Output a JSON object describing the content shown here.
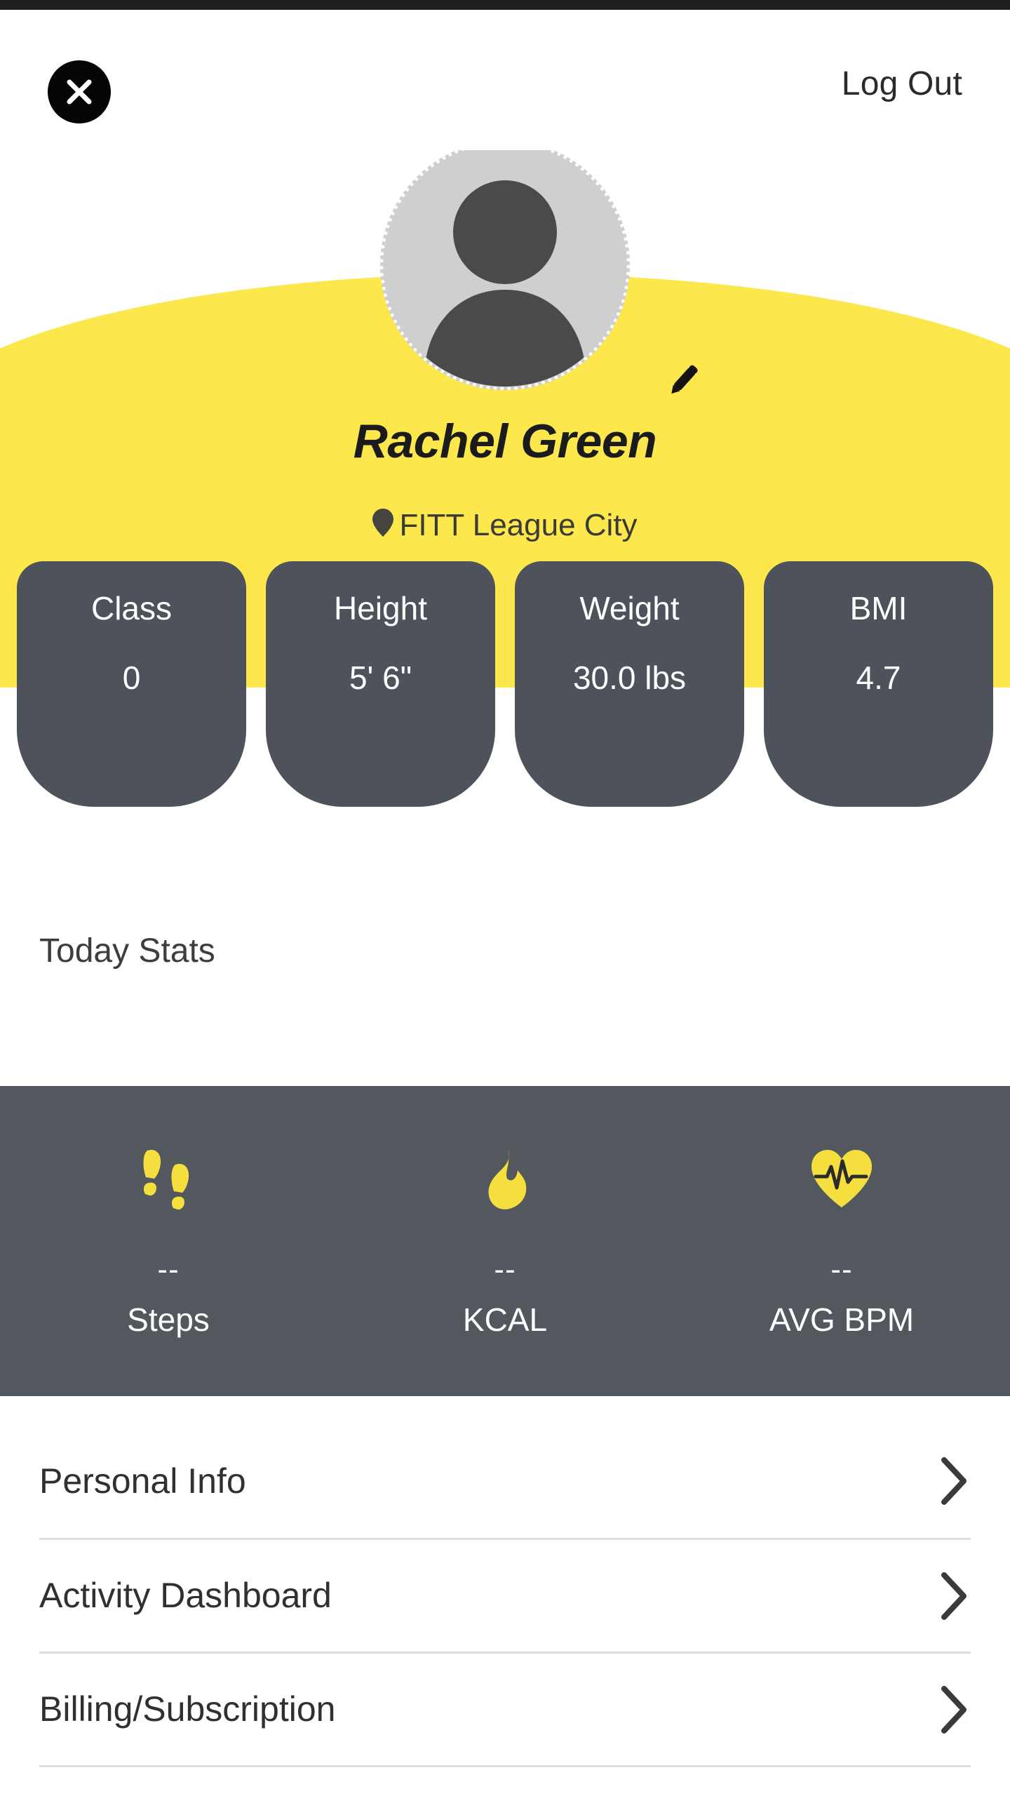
{
  "theme": {
    "brand_yellow": "#FCE74C",
    "dark_panel": "#53575E",
    "card_gray": "#4E525A",
    "text_dark": "#303030",
    "status_bar": "#1F1F1F"
  },
  "header": {
    "close_icon": "close-icon",
    "logout_label": "Log Out"
  },
  "profile": {
    "avatar_icon": "default-avatar-person-icon",
    "edit_icon": "pencil-edit-icon",
    "name": "Rachel Green",
    "location_icon": "location-pin-icon",
    "location": "FITT League City"
  },
  "stat_cards": [
    {
      "label": "Class",
      "value": "0"
    },
    {
      "label": "Height",
      "value": "5' 6\""
    },
    {
      "label": "Weight",
      "value": "30.0 lbs"
    },
    {
      "label": "BMI",
      "value": "4.7"
    }
  ],
  "today_stats": {
    "heading": "Today Stats",
    "items": [
      {
        "icon": "footsteps-icon",
        "value": "--",
        "label": "Steps"
      },
      {
        "icon": "flame-icon",
        "value": "--",
        "label": "KCAL"
      },
      {
        "icon": "heart-pulse-icon",
        "value": "--",
        "label": "AVG BPM"
      }
    ]
  },
  "menu": {
    "items": [
      {
        "label": "Personal Info",
        "chevron": "chevron-right-icon"
      },
      {
        "label": "Activity Dashboard",
        "chevron": "chevron-right-icon"
      },
      {
        "label": "Billing/Subscription",
        "chevron": "chevron-right-icon"
      }
    ]
  }
}
